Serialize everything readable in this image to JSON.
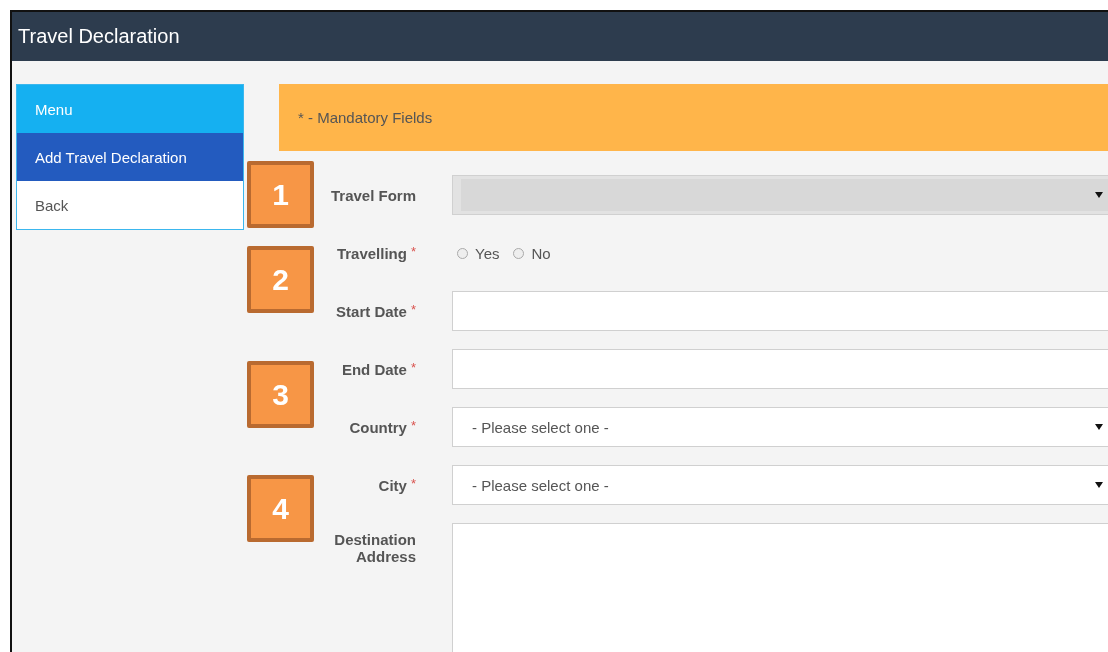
{
  "window": {
    "title": "Travel Declaration"
  },
  "sidebar": {
    "header": "Menu",
    "items": [
      {
        "label": "Add Travel Declaration",
        "selected": true
      },
      {
        "label": "Back",
        "selected": false
      }
    ]
  },
  "notice": "* - Mandatory Fields",
  "annotations": [
    "1",
    "2",
    "3",
    "4"
  ],
  "fields": [
    {
      "label": "Travel Form",
      "kind": "select",
      "disabled": true
    },
    {
      "label": "Travelling",
      "required_mark": "*",
      "kind": "radio",
      "options": [
        {
          "label": "Yes",
          "selected": false
        },
        {
          "label": "No",
          "selected": false
        }
      ]
    },
    {
      "label": "Start Date",
      "required_mark": "*",
      "kind": "text",
      "disabled": false
    },
    {
      "label": "End Date",
      "required_mark": "*",
      "kind": "text",
      "disabled": false
    },
    {
      "label": "Country",
      "required_mark": "*",
      "kind": "select",
      "disabled": false,
      "placeholder": "- Please select one -"
    },
    {
      "label": "City",
      "required_mark": "*",
      "kind": "select",
      "disabled": false,
      "placeholder": "- Please select one -"
    },
    {
      "label": "Destination Address",
      "kind": "textarea",
      "disabled": false
    }
  ]
}
